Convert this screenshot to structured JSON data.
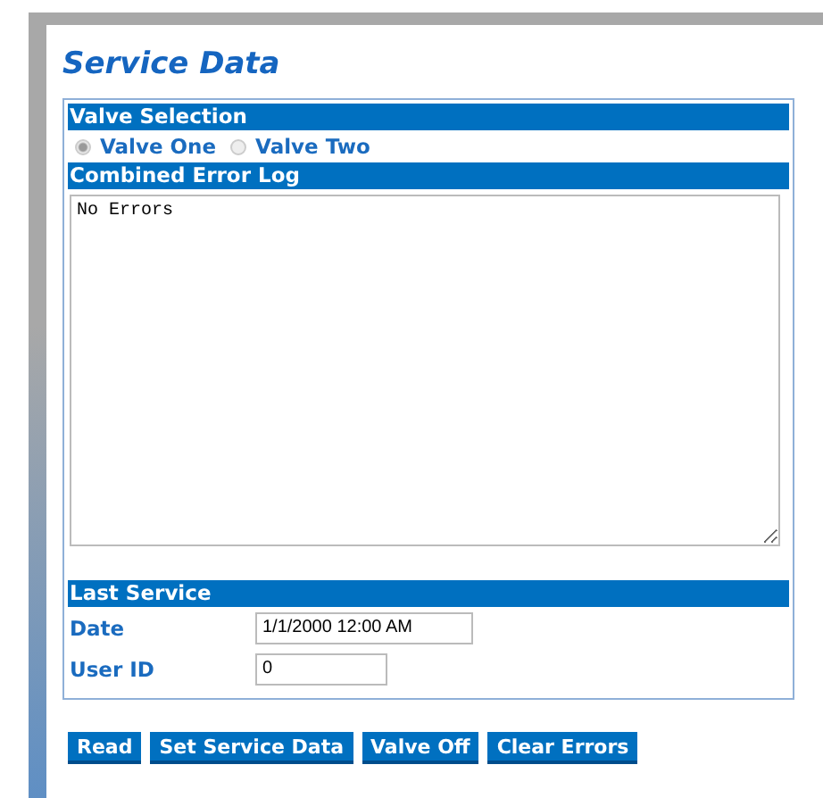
{
  "title": "Service Data",
  "valve_selection": {
    "heading": "Valve Selection",
    "options": [
      {
        "label": "Valve One",
        "selected": true
      },
      {
        "label": "Valve Two",
        "selected": false
      }
    ]
  },
  "error_log": {
    "heading": "Combined Error Log",
    "value": "No Errors"
  },
  "last_service": {
    "heading": "Last Service",
    "fields": [
      {
        "label": "Date",
        "value": "1/1/2000 12:00 AM",
        "kind": "wide"
      },
      {
        "label": "User ID",
        "value": "0",
        "kind": "narrow"
      }
    ]
  },
  "buttons": [
    "Read",
    "Set Service Data",
    "Valve Off",
    "Clear Errors"
  ]
}
